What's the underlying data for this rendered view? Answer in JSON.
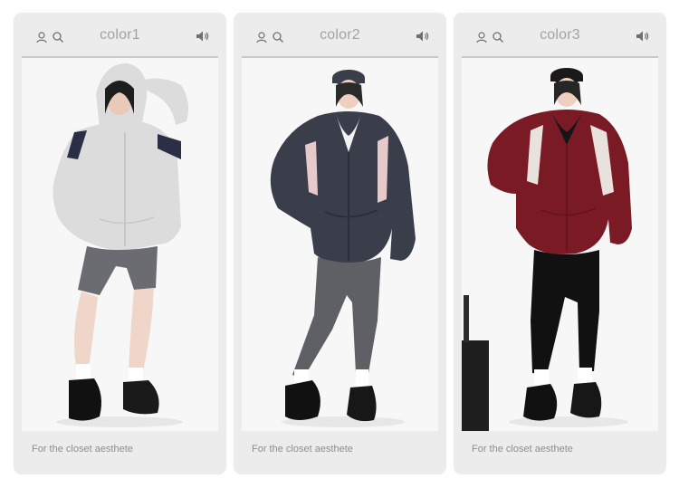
{
  "cards": [
    {
      "title": "color1",
      "caption": "For the closet aesthete",
      "product_color": "#dcdcdc",
      "accent_color": "#2a2f47",
      "icons": [
        "user-icon",
        "search-icon",
        "speaker-icon"
      ]
    },
    {
      "title": "color2",
      "caption": "For the closet aesthete",
      "product_color": "#3a3e4b",
      "accent_color": "#e8c9c9",
      "icons": [
        "user-icon",
        "search-icon",
        "speaker-icon"
      ]
    },
    {
      "title": "color3",
      "caption": "For the closet aesthete",
      "product_color": "#7a1a25",
      "accent_color": "#e9e2dc",
      "icons": [
        "user-icon",
        "search-icon",
        "speaker-icon"
      ]
    }
  ]
}
